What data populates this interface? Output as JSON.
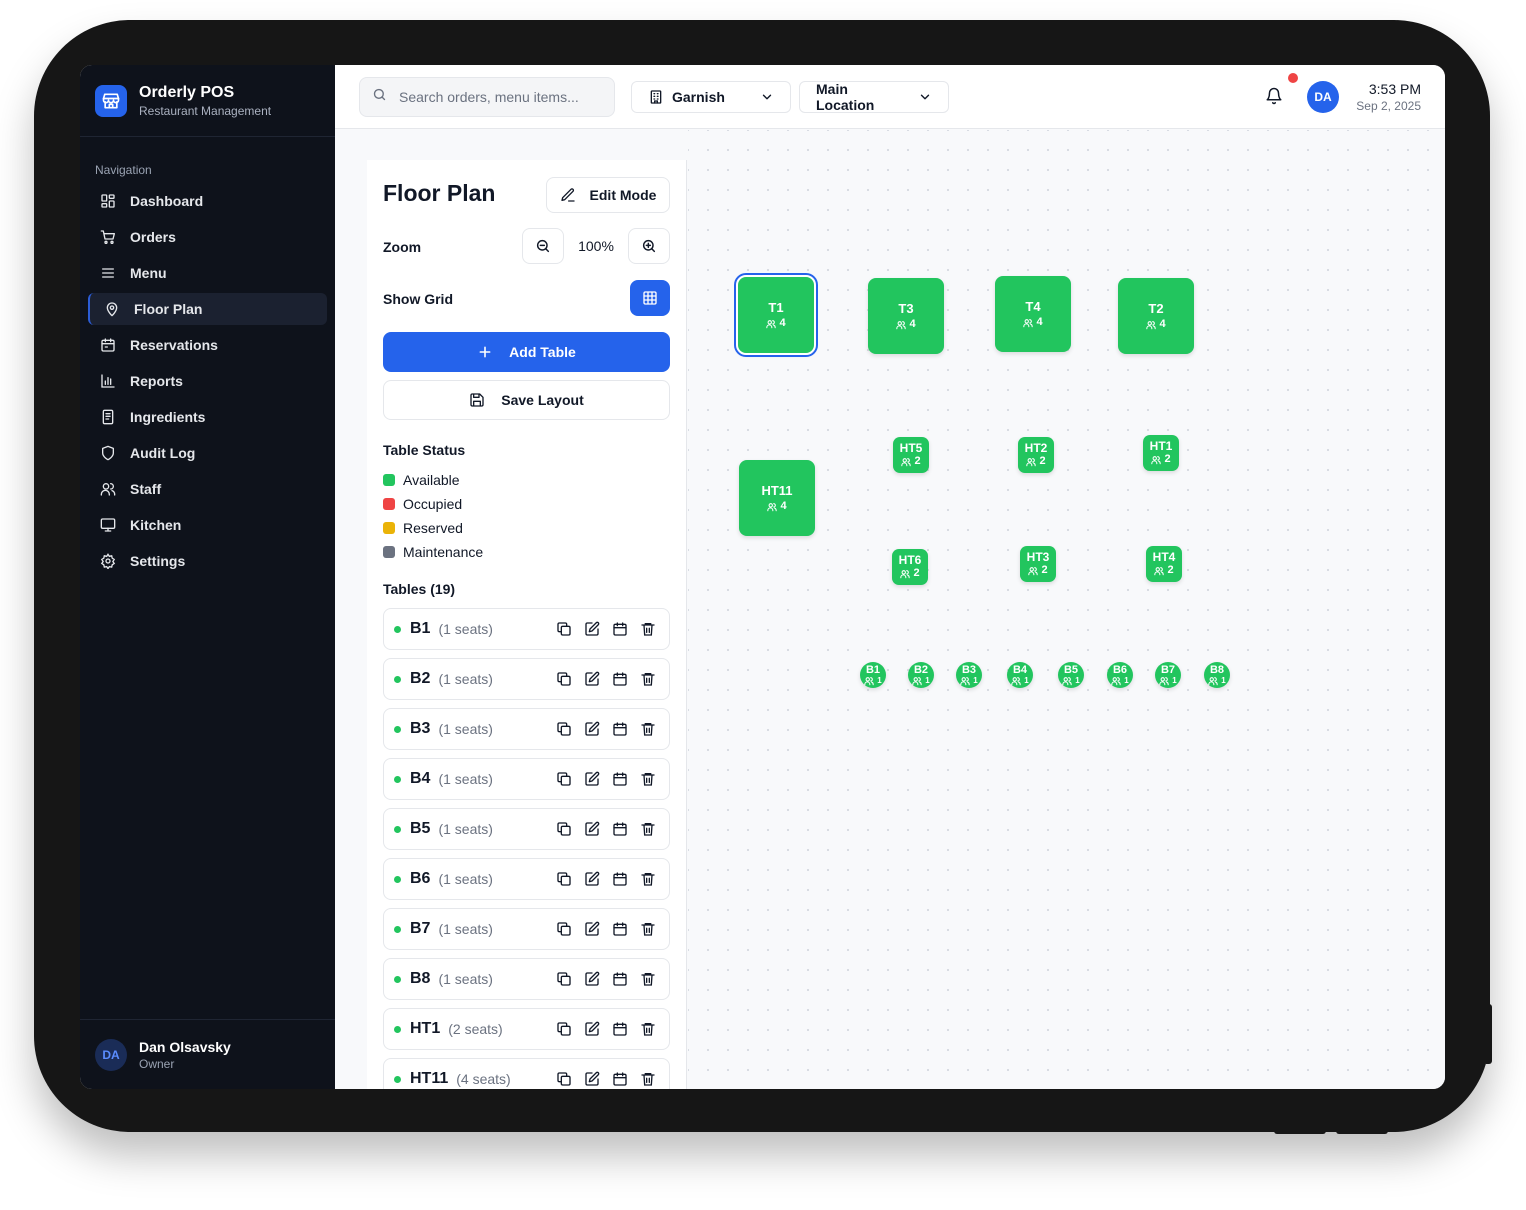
{
  "app": {
    "name": "Orderly POS",
    "subtitle": "Restaurant Management"
  },
  "sidebar": {
    "heading": "Navigation",
    "items": [
      {
        "label": "Dashboard",
        "icon": "dashboard-icon",
        "active": false
      },
      {
        "label": "Orders",
        "icon": "cart-icon",
        "active": false
      },
      {
        "label": "Menu",
        "icon": "menu-icon",
        "active": false
      },
      {
        "label": "Floor Plan",
        "icon": "map-pin-icon",
        "active": true
      },
      {
        "label": "Reservations",
        "icon": "calendar-icon",
        "active": false
      },
      {
        "label": "Reports",
        "icon": "bar-chart-icon",
        "active": false
      },
      {
        "label": "Ingredients",
        "icon": "receipt-icon",
        "active": false
      },
      {
        "label": "Audit Log",
        "icon": "shield-icon",
        "active": false
      },
      {
        "label": "Staff",
        "icon": "users-icon",
        "active": false
      },
      {
        "label": "Kitchen",
        "icon": "monitor-icon",
        "active": false
      },
      {
        "label": "Settings",
        "icon": "gear-icon",
        "active": false
      }
    ],
    "user": {
      "initials": "DA",
      "name": "Dan Olsavsky",
      "role": "Owner"
    }
  },
  "topbar": {
    "search_placeholder": "Search orders, menu items...",
    "restaurant": "Garnish",
    "location": "Main Location",
    "avatar_initials": "DA",
    "time": "3:53 PM",
    "date": "Sep 2, 2025",
    "notification_dot": true
  },
  "panel": {
    "title": "Floor Plan",
    "edit_mode_label": "Edit Mode",
    "zoom_label": "Zoom",
    "zoom_value": "100%",
    "show_grid_label": "Show Grid",
    "show_grid": true,
    "add_table_label": "Add Table",
    "save_layout_label": "Save Layout",
    "status_heading": "Table Status",
    "statuses": [
      {
        "label": "Available",
        "color": "#22c55e"
      },
      {
        "label": "Occupied",
        "color": "#ef4444"
      },
      {
        "label": "Reserved",
        "color": "#eab308"
      },
      {
        "label": "Maintenance",
        "color": "#6b7280"
      }
    ],
    "tables_heading": "Tables (19)",
    "tables": [
      {
        "name": "B1",
        "seats": "(1 seats)"
      },
      {
        "name": "B2",
        "seats": "(1 seats)"
      },
      {
        "name": "B3",
        "seats": "(1 seats)"
      },
      {
        "name": "B4",
        "seats": "(1 seats)"
      },
      {
        "name": "B5",
        "seats": "(1 seats)"
      },
      {
        "name": "B6",
        "seats": "(1 seats)"
      },
      {
        "name": "B7",
        "seats": "(1 seats)"
      },
      {
        "name": "B8",
        "seats": "(1 seats)"
      },
      {
        "name": "HT1",
        "seats": "(2 seats)"
      },
      {
        "name": "HT11",
        "seats": "(4 seats)"
      }
    ]
  },
  "floor": {
    "tables": [
      {
        "name": "T1",
        "seats": "4",
        "size": "big",
        "selected": true
      },
      {
        "name": "T3",
        "seats": "4",
        "size": "big"
      },
      {
        "name": "T4",
        "seats": "4",
        "size": "big"
      },
      {
        "name": "T2",
        "seats": "4",
        "size": "big"
      },
      {
        "name": "HT11",
        "seats": "4",
        "size": "big"
      },
      {
        "name": "HT5",
        "seats": "2",
        "size": "med"
      },
      {
        "name": "HT2",
        "seats": "2",
        "size": "med"
      },
      {
        "name": "HT1",
        "seats": "2",
        "size": "med"
      },
      {
        "name": "HT6",
        "seats": "2",
        "size": "med"
      },
      {
        "name": "HT3",
        "seats": "2",
        "size": "med"
      },
      {
        "name": "HT4",
        "seats": "2",
        "size": "med"
      },
      {
        "name": "B1",
        "seats": "1",
        "size": "sm"
      },
      {
        "name": "B2",
        "seats": "1",
        "size": "sm"
      },
      {
        "name": "B3",
        "seats": "1",
        "size": "sm"
      },
      {
        "name": "B4",
        "seats": "1",
        "size": "sm"
      },
      {
        "name": "B5",
        "seats": "1",
        "size": "sm"
      },
      {
        "name": "B6",
        "seats": "1",
        "size": "sm"
      },
      {
        "name": "B7",
        "seats": "1",
        "size": "sm"
      },
      {
        "name": "B8",
        "seats": "1",
        "size": "sm"
      }
    ]
  }
}
